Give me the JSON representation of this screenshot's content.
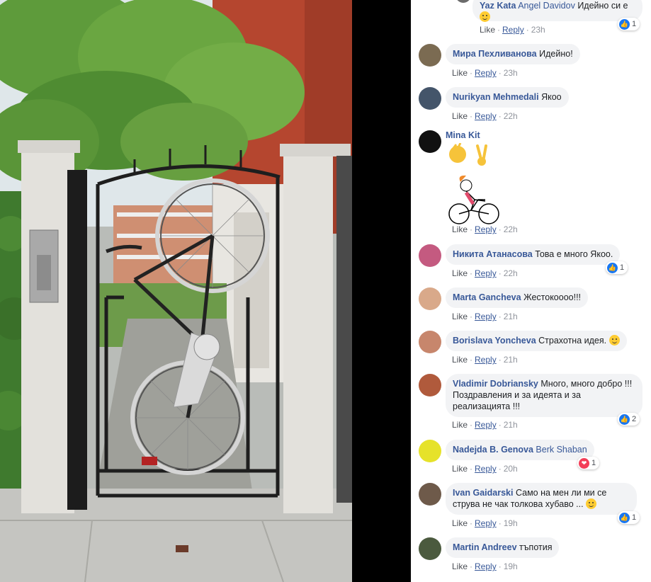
{
  "comments": [
    {
      "author": "Yaz Kata",
      "tag": "Angel Davidov",
      "text": "Идейно си е",
      "time": "23h",
      "reaction_count": "1",
      "reaction_type": "like",
      "emoji": "grin"
    },
    {
      "author": "Мира Пехливанова",
      "text": "Идейно!",
      "time": "23h"
    },
    {
      "author": "Nurikyan Mehmedali",
      "text": "Якоо",
      "time": "22h"
    },
    {
      "author": "Mina Kit",
      "text": "",
      "time": "22h",
      "sticker": "clap-victory-bike"
    },
    {
      "author": "Никита Атанасова",
      "text": "Това е много Якоо.",
      "time": "22h",
      "reaction_count": "1",
      "reaction_type": "like"
    },
    {
      "author": "Marta Gancheva",
      "text": "Жестокоооо!!!",
      "time": "21h"
    },
    {
      "author": "Borislava Yoncheva",
      "text": "Страхотна идея.",
      "time": "21h",
      "emoji": "smile"
    },
    {
      "author": "Vladimir Dobriansky",
      "text": "Много, много добро !!! Поздравления и за идеята и за реализацията !!!",
      "time": "21h",
      "reaction_count": "2",
      "reaction_type": "like"
    },
    {
      "author": "Nadejda B. Genova",
      "tag": "Berk Shaban",
      "text": "",
      "time": "20h",
      "reaction_count": "1",
      "reaction_type": "love"
    },
    {
      "author": "Ivan Gaidarski",
      "text": "Само на мен ли ми се струва не чак толкова хубаво ...",
      "time": "19h",
      "reaction_count": "1",
      "reaction_type": "like",
      "emoji": "thinking"
    },
    {
      "author": "Martin Andreev",
      "text": "тъпотия",
      "time": "19h"
    }
  ],
  "labels": {
    "like": "Like",
    "reply": "Reply"
  },
  "colors": {
    "author": "#385898",
    "bubble": "#f2f3f5",
    "like": "#1877f2",
    "love": "#f33e58"
  }
}
